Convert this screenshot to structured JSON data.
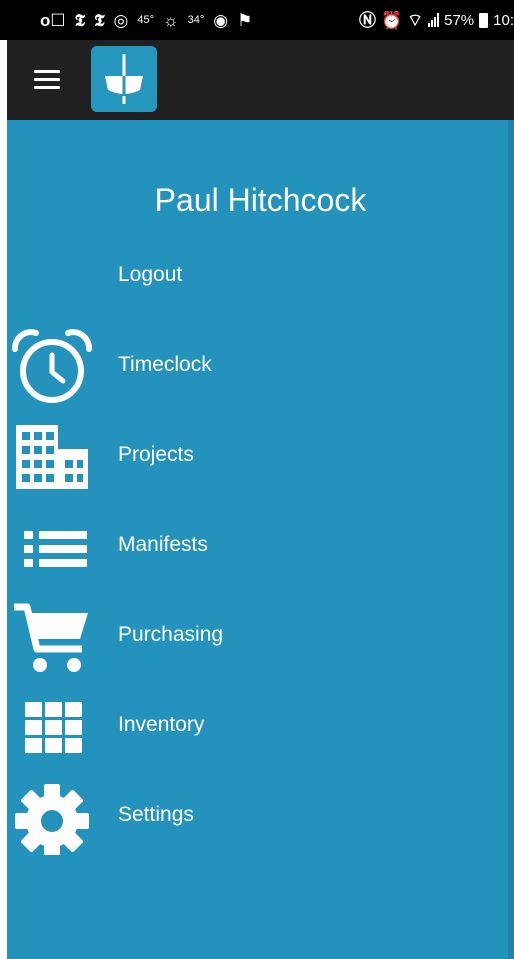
{
  "status_bar": {
    "temp_1": "45°",
    "temp_2": "34°",
    "battery": "57%",
    "time": "10:"
  },
  "user": {
    "name": "Paul Hitchcock"
  },
  "menu": {
    "logout": "Logout",
    "items": [
      {
        "label": "Timeclock",
        "icon": "alarm-clock-icon"
      },
      {
        "label": "Projects",
        "icon": "building-icon"
      },
      {
        "label": "Manifests",
        "icon": "list-icon"
      },
      {
        "label": "Purchasing",
        "icon": "shopping-cart-icon"
      },
      {
        "label": "Inventory",
        "icon": "grid-icon"
      },
      {
        "label": "Settings",
        "icon": "gear-icon"
      }
    ]
  },
  "colors": {
    "drawer_bg": "#2393bd",
    "app_bar_bg": "#212121",
    "status_bar_bg": "#000000",
    "text": "#ffffff"
  }
}
